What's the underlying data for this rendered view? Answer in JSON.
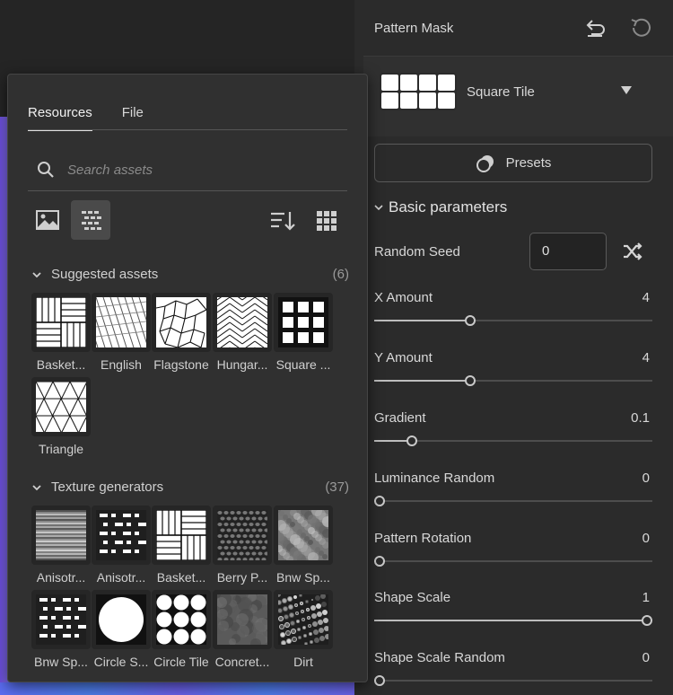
{
  "panel": {
    "title": "Pattern Mask",
    "pattern_name": "Square Tile",
    "presets_label": "Presets",
    "section_title": "Basic parameters",
    "random_seed_label": "Random Seed",
    "random_seed_value": "0",
    "params": [
      {
        "label": "X Amount",
        "value": "4",
        "fraction": 0.34
      },
      {
        "label": "Y Amount",
        "value": "4",
        "fraction": 0.34
      },
      {
        "label": "Gradient",
        "value": "0.1",
        "fraction": 0.12
      },
      {
        "label": "Luminance Random",
        "value": "0",
        "fraction": 0.0
      },
      {
        "label": "Pattern Rotation",
        "value": "0",
        "fraction": 0.0
      },
      {
        "label": "Shape Scale",
        "value": "1",
        "fraction": 1.0
      },
      {
        "label": "Shape Scale Random",
        "value": "0",
        "fraction": 0.0
      }
    ]
  },
  "popup": {
    "tabs": [
      {
        "label": "Resources",
        "active": true
      },
      {
        "label": "File",
        "active": false
      }
    ],
    "search_placeholder": "Search assets",
    "suggested": {
      "title": "Suggested assets",
      "count": "(6)",
      "items": [
        "Basket...",
        "English",
        "Flagstone",
        "Hungar...",
        "Square ...",
        "Triangle"
      ]
    },
    "textures": {
      "title": "Texture generators",
      "count": "(37)",
      "items": [
        "Anisotr...",
        "Anisotr...",
        "Basket...",
        "Berry P...",
        "Bnw Sp...",
        "Bnw Sp...",
        "Circle S...",
        "Circle Tile",
        "Concret...",
        "Dirt"
      ]
    }
  },
  "icons": {
    "undo": "undo-icon",
    "reset": "reset-icon",
    "presets": "presets-icon",
    "shuffle": "shuffle-icon",
    "search": "search-icon",
    "image_filter": "image-icon",
    "pattern_filter": "pattern-icon",
    "sort": "sort-icon",
    "grid": "grid-view-icon"
  },
  "colors": {
    "panel_bg": "#2b2b2b",
    "popup_bg": "#303030",
    "accent": "#e0e0e0"
  }
}
